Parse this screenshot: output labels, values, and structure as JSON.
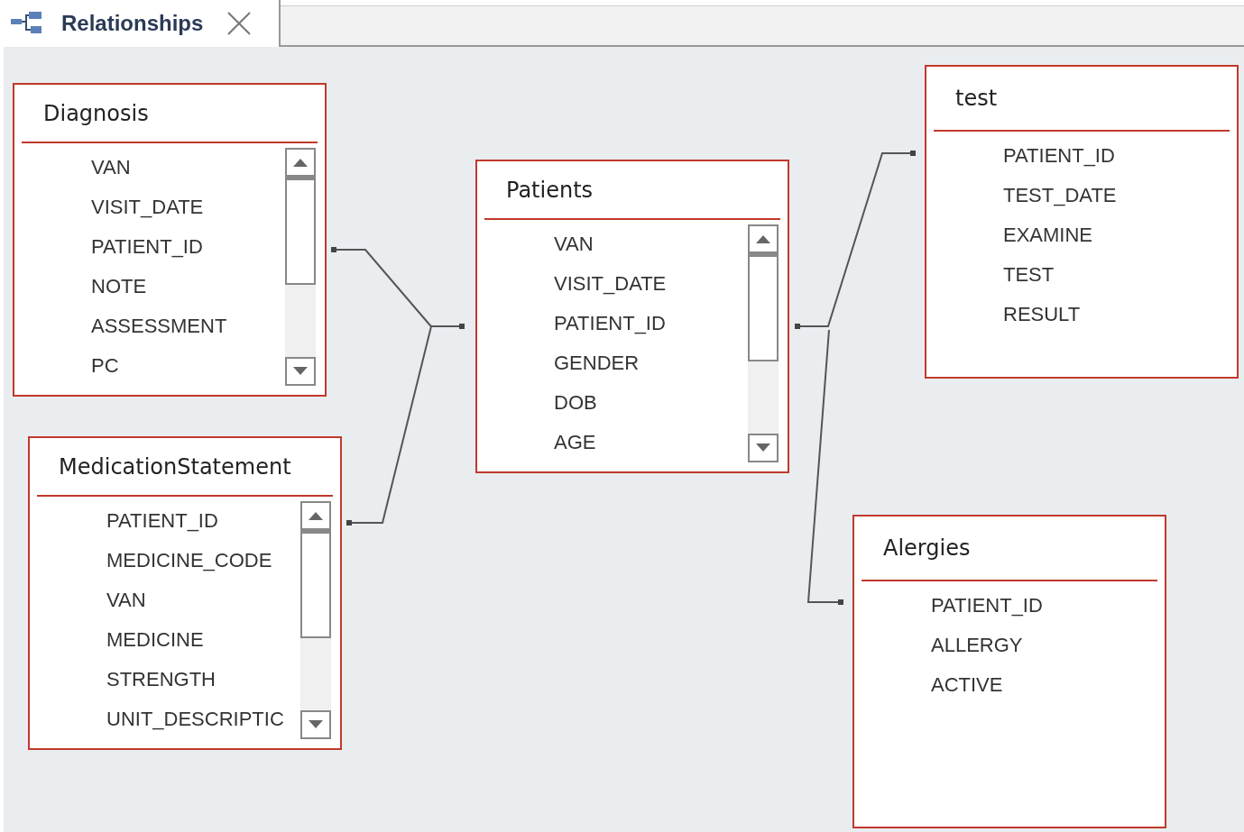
{
  "tab": {
    "title": "Relationships"
  },
  "tables": [
    {
      "name": "Diagnosis",
      "scrollable": true,
      "fields": [
        "VAN",
        "VISIT_DATE",
        "PATIENT_ID",
        "NOTE",
        "ASSESSMENT",
        "PC"
      ]
    },
    {
      "name": "MedicationStatement",
      "scrollable": true,
      "fields": [
        "PATIENT_ID",
        "MEDICINE_CODE",
        "VAN",
        "MEDICINE",
        "STRENGTH",
        "UNIT_DESCRIPTIC"
      ]
    },
    {
      "name": "Patients",
      "scrollable": true,
      "fields": [
        "VAN",
        "VISIT_DATE",
        "PATIENT_ID",
        "GENDER",
        "DOB",
        "AGE"
      ]
    },
    {
      "name": "test",
      "scrollable": false,
      "fields": [
        "PATIENT_ID",
        "TEST_DATE",
        "EXAMINE",
        "TEST",
        "RESULT"
      ]
    },
    {
      "name": "Alergies",
      "scrollable": false,
      "fields": [
        "PATIENT_ID",
        "ALLERGY",
        "ACTIVE"
      ]
    }
  ]
}
